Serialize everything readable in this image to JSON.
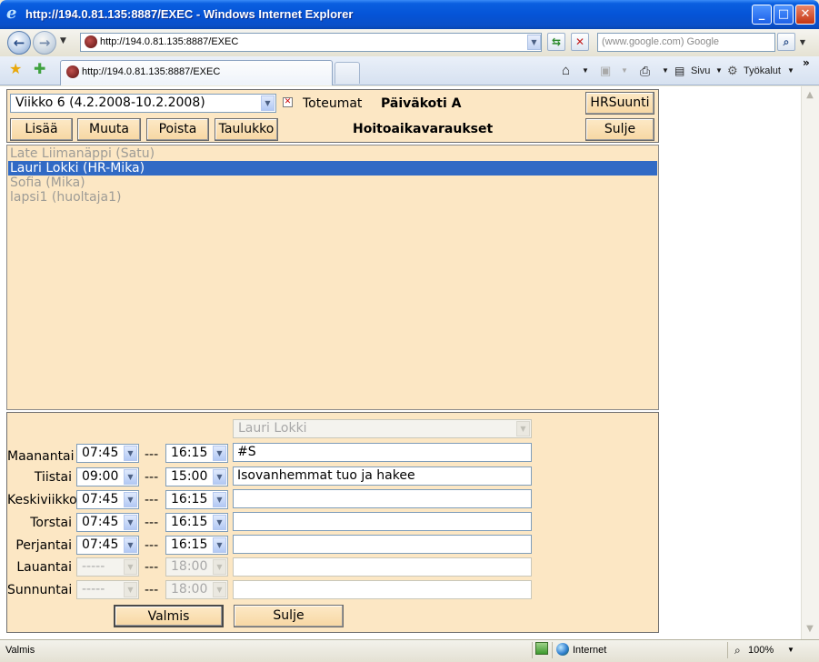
{
  "window": {
    "title": "http://194.0.81.135:8887/EXEC - Windows Internet Explorer",
    "min_glyph": "_",
    "max_glyph": "□",
    "close_glyph": "✕"
  },
  "browser": {
    "address": "http://194.0.81.135:8887/EXEC",
    "search_placeholder": "(www.google.com) Google",
    "tab_title": "http://194.0.81.135:8887/EXEC",
    "commands": {
      "page": "Sivu",
      "tools": "Työkalut"
    },
    "overflow": "»"
  },
  "app": {
    "week_select": "Viikko 6 (4.2.2008-10.2.2008)",
    "checkbox_label": "Toteumat",
    "checkbox_checked": true,
    "unit_title": "Päiväkoti A",
    "section_title": "Hoitoaikavaraukset",
    "buttons": {
      "add": "Lisää",
      "edit": "Muuta",
      "delete": "Poista",
      "table": "Taulukko",
      "hr": "HRSuunti",
      "close_top": "Sulje",
      "done": "Valmis",
      "close_bottom": "Sulje"
    },
    "children": [
      {
        "label": "Late Liimanäppi (Satu)",
        "selected": false
      },
      {
        "label": "Lauri Lokki (HR-Mika)",
        "selected": true
      },
      {
        "label": "Sofia (Mika)",
        "selected": false
      },
      {
        "label": "lapsi1 (huoltaja1)",
        "selected": false
      }
    ],
    "selected_child": "Lauri Lokki",
    "separator": "---",
    "days": [
      {
        "name": "Maanantai",
        "start": "07:45",
        "end": "16:15",
        "note": "#S",
        "enabled": true
      },
      {
        "name": "Tiistai",
        "start": "09:00",
        "end": "15:00",
        "note": "Isovanhemmat tuo ja hakee",
        "enabled": true
      },
      {
        "name": "Keskiviikko",
        "start": "07:45",
        "end": "16:15",
        "note": "",
        "enabled": true
      },
      {
        "name": "Torstai",
        "start": "07:45",
        "end": "16:15",
        "note": "",
        "enabled": true
      },
      {
        "name": "Perjantai",
        "start": "07:45",
        "end": "16:15",
        "note": "",
        "enabled": true
      },
      {
        "name": "Lauantai",
        "start": "-----",
        "end": "18:00",
        "note": "",
        "enabled": false
      },
      {
        "name": "Sunnuntai",
        "start": "-----",
        "end": "18:00",
        "note": "",
        "enabled": false
      }
    ]
  },
  "status": {
    "left": "Valmis",
    "zone": "Internet",
    "zoom": "100%"
  },
  "colors": {
    "panel": "#fce7c4",
    "selection": "#316ac5",
    "titlebar": "#0554d7"
  }
}
